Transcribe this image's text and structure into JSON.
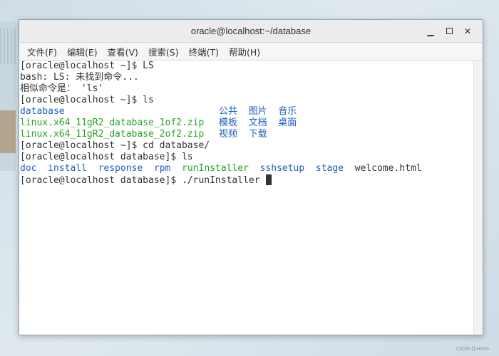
{
  "window": {
    "title": "oracle@localhost:~/database"
  },
  "menus": [
    {
      "label": "文件(F)"
    },
    {
      "label": "编辑(E)"
    },
    {
      "label": "查看(V)"
    },
    {
      "label": "搜索(S)"
    },
    {
      "label": "终端(T)"
    },
    {
      "label": "帮助(H)"
    }
  ],
  "terminal": {
    "l1": "[oracle@localhost ~]$ LS",
    "l2": "bash: LS: 未找到命令...",
    "l3": "相似命令是： 'ls'",
    "l4": "[oracle@localhost ~]$ ls",
    "ls_home": [
      {
        "name": "database",
        "color": "#1f5fbf",
        "cn": "公共  图片  音乐"
      },
      {
        "name": "linux.x64_11gR2_database_1of2.zip",
        "color": "#27a327",
        "cn": "模板  文档  桌面"
      },
      {
        "name": "linux.x64_11gR2_database_2of2.zip",
        "color": "#27a327",
        "cn": "视频  下载"
      }
    ],
    "l8": "[oracle@localhost ~]$ cd database/",
    "l9": "[oracle@localhost database]$ ls",
    "ls_db": [
      {
        "name": "doc",
        "color": "#1f5fbf"
      },
      {
        "name": "install",
        "color": "#1f5fbf"
      },
      {
        "name": "response",
        "color": "#1f5fbf"
      },
      {
        "name": "rpm",
        "color": "#1f5fbf"
      },
      {
        "name": "runInstaller",
        "color": "#27a327"
      },
      {
        "name": "sshsetup",
        "color": "#1f5fbf"
      },
      {
        "name": "stage",
        "color": "#1f5fbf"
      },
      {
        "name": "welcome.html",
        "color": "#2e3436"
      }
    ],
    "l11": "[oracle@localhost database]$ ./runInstaller "
  },
  "icons": {
    "minimize": "minimize-icon",
    "maximize": "maximize-icon",
    "close": "close-icon"
  },
  "watermark": "CSDN @Hello"
}
